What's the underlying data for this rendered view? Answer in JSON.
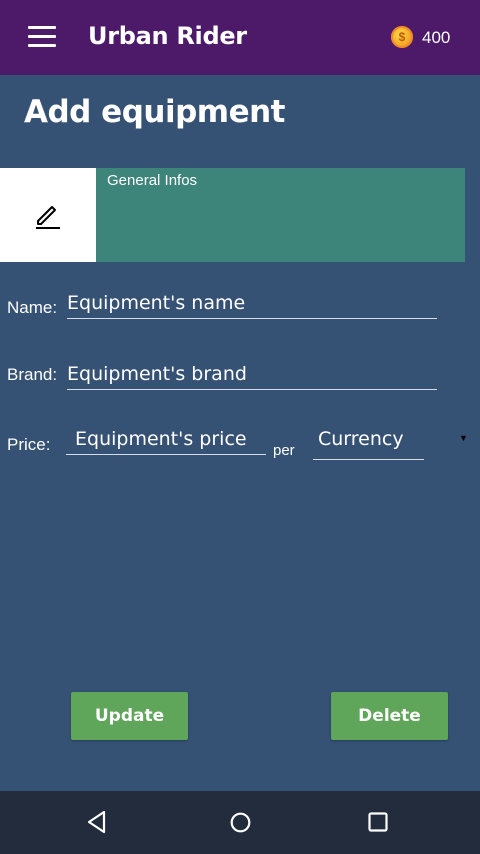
{
  "appbar": {
    "title": "Urban Rider",
    "coins": "400",
    "menu_icon": "hamburger-menu-icon",
    "coin_icon": "coin-icon"
  },
  "page": {
    "title": "Add equipment"
  },
  "tabs": {
    "edit_icon": "pencil-edit-icon",
    "general_label": "General Infos"
  },
  "form": {
    "name_label": "Name:",
    "name_placeholder": "Equipment's name",
    "brand_label": "Brand:",
    "brand_placeholder": "Equipment's brand",
    "price_label": "Price:",
    "price_placeholder": "Equipment's price",
    "per_label": "per",
    "currency_value": "Currency"
  },
  "actions": {
    "update_label": "Update",
    "delete_label": "Delete"
  },
  "navbar": {
    "back_icon": "back-triangle-icon",
    "home_icon": "home-circle-icon",
    "recent_icon": "recent-apps-square-icon"
  },
  "colors": {
    "appbar": "#4d1a6a",
    "background": "#355174",
    "tab_active": "#3d857a",
    "button": "#5fa55a",
    "navbar": "#222c3c"
  }
}
